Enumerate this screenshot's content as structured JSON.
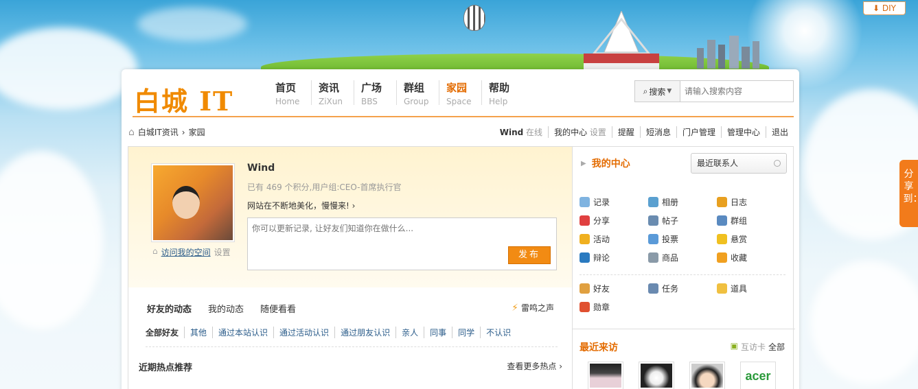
{
  "diy_label": "DIY",
  "share_label": "分享到：",
  "logo": "白城 IT",
  "nav": [
    {
      "cn": "首页",
      "en": "Home"
    },
    {
      "cn": "资讯",
      "en": "ZiXun"
    },
    {
      "cn": "广场",
      "en": "BBS"
    },
    {
      "cn": "群组",
      "en": "Group"
    },
    {
      "cn": "家园",
      "en": "Space",
      "active": true
    },
    {
      "cn": "帮助",
      "en": "Help"
    }
  ],
  "search": {
    "button": "搜索",
    "placeholder": "请输入搜索内容"
  },
  "breadcrumb": {
    "site": "白城IT资讯",
    "sep": "›",
    "current": "家园"
  },
  "topbar": {
    "user": "Wind",
    "online": "在线",
    "center": "我的中心",
    "settings": "设置",
    "remind": "提醒",
    "pm": "短消息",
    "portal": "门户管理",
    "admin": "管理中心",
    "logout": "退出"
  },
  "profile": {
    "name": "Wind",
    "info": "已有 469 个积分,用户组:CEO-首席执行官",
    "message": "网站在不断地美化，慢慢来!",
    "visit": "访问我的空间",
    "settings": "设置",
    "status_placeholder": "你可以更新记录, 让好友们知道你在做什么...",
    "publish": "发布"
  },
  "feed_tabs": [
    "好友的动态",
    "我的动态",
    "随便看看"
  ],
  "thunder": "雷鸣之声",
  "filters": [
    "全部好友",
    "其他",
    "通过本站认识",
    "通过活动认识",
    "通过朋友认识",
    "亲人",
    "同事",
    "同学",
    "不认识"
  ],
  "hot": {
    "title": "近期热点推荐",
    "more": "查看更多热点 ›"
  },
  "center": {
    "title": "我的中心",
    "contacts": "最近联系人",
    "items": [
      {
        "label": "记录",
        "icon": "speech-bubble-icon",
        "color": "#7fb3e0"
      },
      {
        "label": "相册",
        "icon": "photo-icon",
        "color": "#5aa0d0"
      },
      {
        "label": "日志",
        "icon": "notebook-icon",
        "color": "#e8a020"
      },
      {
        "label": "分享",
        "icon": "heart-icon",
        "color": "#e04040"
      },
      {
        "label": "帖子",
        "icon": "magnifier-icon",
        "color": "#6a8cb0"
      },
      {
        "label": "群组",
        "icon": "group-icon",
        "color": "#5a8ac0"
      },
      {
        "label": "活动",
        "icon": "people-icon",
        "color": "#f0b020"
      },
      {
        "label": "投票",
        "icon": "bar-chart-icon",
        "color": "#5a9ad8"
      },
      {
        "label": "悬赏",
        "icon": "gold-icon",
        "color": "#f0c020"
      },
      {
        "label": "辩论",
        "icon": "vs-icon",
        "color": "#2a7ac0"
      },
      {
        "label": "商品",
        "icon": "cart-icon",
        "color": "#8a9aa8"
      },
      {
        "label": "收藏",
        "icon": "star-icon",
        "color": "#f0a020"
      }
    ],
    "items2": [
      {
        "label": "好友",
        "icon": "handshake-icon",
        "color": "#e0a040"
      },
      {
        "label": "任务",
        "icon": "task-icon",
        "color": "#6a8ab0"
      },
      {
        "label": "道具",
        "icon": "wand-icon",
        "color": "#f0c040"
      },
      {
        "label": "勋章",
        "icon": "medal-icon",
        "color": "#e05030"
      }
    ]
  },
  "visitors": {
    "title": "最近来访",
    "card": "互访卡",
    "all": "全部"
  }
}
